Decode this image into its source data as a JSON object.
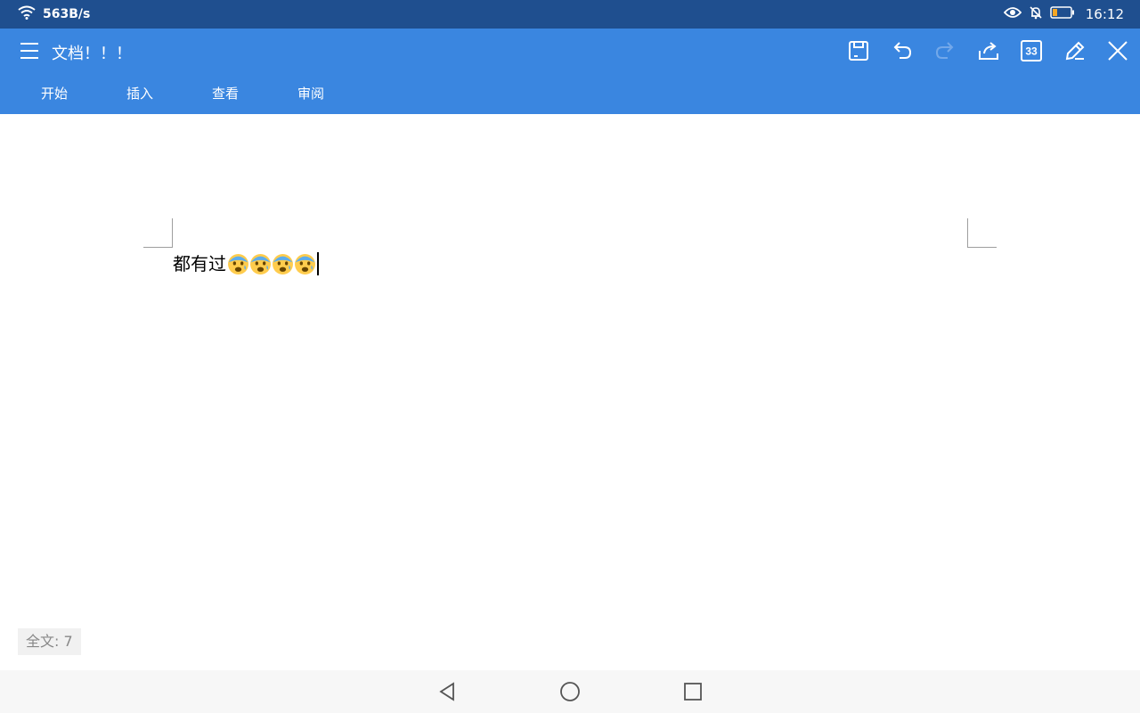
{
  "status_bar": {
    "network_speed": "563B/s",
    "time": "16:12",
    "icons": [
      "wifi-icon",
      "eye-icon",
      "bell-off-icon",
      "battery-icon"
    ]
  },
  "app_bar": {
    "title": "文档！！！",
    "color": "#3a86e0",
    "toolbar_icons": [
      "save-icon",
      "undo-icon",
      "redo-icon",
      "share-icon",
      "page-count-icon",
      "edit-icon",
      "close-icon"
    ],
    "page_badge": "33",
    "tabs": [
      {
        "label": "开始"
      },
      {
        "label": "插入"
      },
      {
        "label": "查看"
      },
      {
        "label": "审阅"
      }
    ]
  },
  "document": {
    "text": "都有过",
    "emoji_count_visible": 4,
    "emoji_icon": "anxious-face-icon"
  },
  "footer": {
    "word_count": "全文: 7"
  },
  "nav_bar": {
    "icons": [
      "back-icon",
      "home-icon",
      "recents-icon"
    ]
  }
}
